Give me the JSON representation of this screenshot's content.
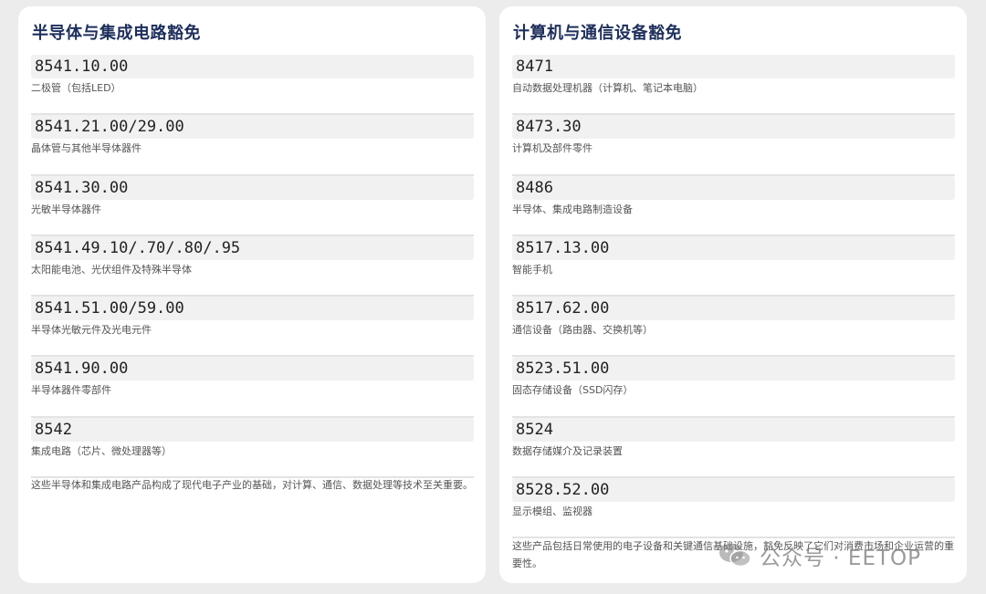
{
  "left": {
    "title": "半导体与集成电路豁免",
    "items": [
      {
        "code": "8541.10.00",
        "desc": "二极管（包括LED）"
      },
      {
        "code": "8541.21.00/29.00",
        "desc": "晶体管与其他半导体器件"
      },
      {
        "code": "8541.30.00",
        "desc": "光敏半导体器件"
      },
      {
        "code": "8541.49.10/.70/.80/.95",
        "desc": "太阳能电池、光伏组件及特殊半导体"
      },
      {
        "code": "8541.51.00/59.00",
        "desc": "半导体光敏元件及光电元件"
      },
      {
        "code": "8541.90.00",
        "desc": "半导体器件零部件"
      },
      {
        "code": "8542",
        "desc": "集成电路（芯片、微处理器等）"
      }
    ],
    "note": "这些半导体和集成电路产品构成了现代电子产业的基础，对计算、通信、数据处理等技术至关重要。"
  },
  "right": {
    "title": "计算机与通信设备豁免",
    "items": [
      {
        "code": "8471",
        "desc": "自动数据处理机器（计算机、笔记本电脑）"
      },
      {
        "code": "8473.30",
        "desc": "计算机及部件零件"
      },
      {
        "code": "8486",
        "desc": "半导体、集成电路制造设备"
      },
      {
        "code": "8517.13.00",
        "desc": "智能手机"
      },
      {
        "code": "8517.62.00",
        "desc": "通信设备（路由器、交换机等）"
      },
      {
        "code": "8523.51.00",
        "desc": "固态存储设备（SSD闪存）"
      },
      {
        "code": "8524",
        "desc": "数据存储媒介及记录装置"
      },
      {
        "code": "8528.52.00",
        "desc": "显示模组、监视器"
      }
    ],
    "note": "这些产品包括日常使用的电子设备和关键通信基础设施，豁免反映了它们对消费市场和企业运营的重要性。"
  },
  "watermark": {
    "text": "公众号 · EETOP",
    "icon": "wechat-icon"
  }
}
